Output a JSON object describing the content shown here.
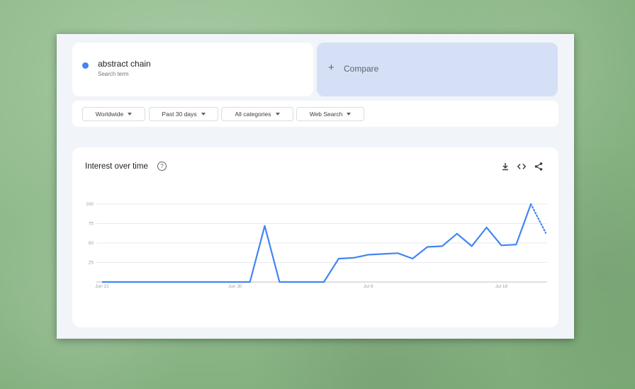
{
  "search": {
    "term": "abstract chain",
    "term_subtitle": "Search term",
    "term_color": "#4285f4",
    "compare_label": "Compare"
  },
  "filters": [
    {
      "label": "Worldwide"
    },
    {
      "label": "Past 30 days"
    },
    {
      "label": "All categories"
    },
    {
      "label": "Web Search"
    }
  ],
  "chart_card": {
    "title": "Interest over time",
    "icons": [
      "help-icon",
      "download-icon",
      "embed-icon",
      "share-icon"
    ]
  },
  "chart_data": {
    "type": "line",
    "title": "Interest over time",
    "xlabel": "",
    "ylabel": "",
    "ylim": [
      0,
      100
    ],
    "yticks": [
      25,
      50,
      75,
      100
    ],
    "xtick_labels": [
      {
        "label": "Jun 21",
        "day_index": 0
      },
      {
        "label": "Jun 30",
        "day_index": 9
      },
      {
        "label": "Jul 9",
        "day_index": 18
      },
      {
        "label": "Jul 18",
        "day_index": 27
      }
    ],
    "grid": true,
    "legend": "none",
    "series": [
      {
        "color": "#4285f4",
        "values": [
          0,
          0,
          0,
          0,
          0,
          0,
          0,
          0,
          0,
          0,
          0,
          72,
          0,
          0,
          0,
          0,
          30,
          31,
          35,
          36,
          37,
          30,
          45,
          46,
          62,
          46,
          70,
          47,
          48,
          100,
          63
        ],
        "partial_from_index": 29
      }
    ]
  }
}
